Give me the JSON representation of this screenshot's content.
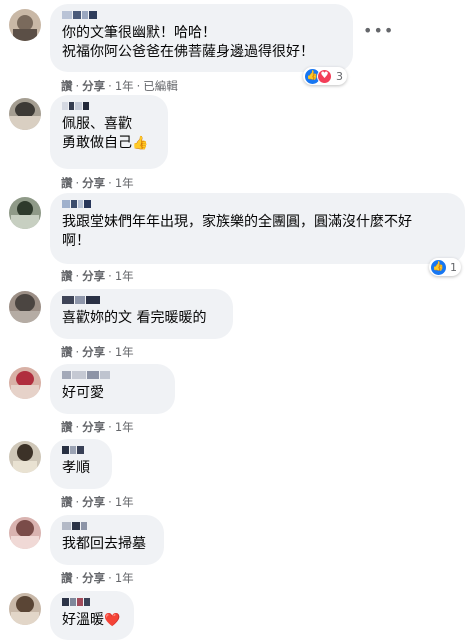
{
  "comments": [
    {
      "text": "你的文筆很幽默！哈哈！\n祝福你阿公爸爸在佛菩薩身邊過得很好！",
      "actions": {
        "reply": "讚",
        "share": "分享",
        "time": "1年",
        "edited": "已編輯"
      },
      "reactions": {
        "count": "3",
        "types": [
          "like-icon",
          "love-icon"
        ]
      },
      "more_icon": "more-horizontal-icon"
    },
    {
      "text": "佩服、喜歡\n勇敢做自己",
      "emoji": "👍",
      "actions": {
        "reply": "讚",
        "share": "分享",
        "time": "1年"
      }
    },
    {
      "text": "我跟堂妹們年年出現，家族樂的全團圓，圓滿沒什麼不好\n啊！",
      "actions": {
        "reply": "讚",
        "share": "分享",
        "time": "1年"
      },
      "reactions": {
        "count": "1",
        "types": [
          "like-icon"
        ]
      }
    },
    {
      "text": "喜歡妳的文 看完暖暖的",
      "actions": {
        "reply": "讚",
        "share": "分享",
        "time": "1年"
      }
    },
    {
      "text": "好可愛",
      "actions": {
        "reply": "讚",
        "share": "分享",
        "time": "1年"
      }
    },
    {
      "text": "孝順",
      "actions": {
        "reply": "讚",
        "share": "分享",
        "time": "1年"
      }
    },
    {
      "text": "我都回去掃墓",
      "actions": {
        "reply": "讚",
        "share": "分享",
        "time": "1年"
      }
    },
    {
      "text": "好溫暖",
      "emoji": "❤️"
    }
  ],
  "colors": {
    "bubble": "#f0f2f5",
    "meta": "#65676b",
    "like": "#1877f2",
    "love": "#f33e58"
  }
}
